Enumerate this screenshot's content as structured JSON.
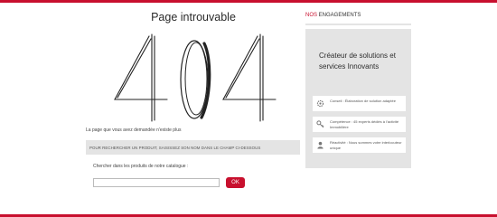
{
  "page": {
    "title": "Page introuvable",
    "error_code": "404",
    "message": "La page que vous avez demandée n'existe plus",
    "info_band": "POUR RECHERCHER UN PRODUIT, SAISISSEZ SON NOM DANS LE CHAMP CI-DESSOUS"
  },
  "search": {
    "label": "Chercher dans les produits de notre catalogue :",
    "value": "",
    "placeholder": "",
    "button_label": "OK"
  },
  "sidebar": {
    "heading_highlight": "NOS",
    "heading_rest": " ENGAGEMENTS",
    "panel_title": "Créateur de solutions et services Innovants",
    "features": [
      {
        "icon": "gear-icon",
        "text": "Conseil : Élaboration de solution adaptée"
      },
      {
        "icon": "key-icon",
        "text": "Compétence : 45 experts dédiés à l'activité Immobilière"
      },
      {
        "icon": "person-icon",
        "text": "Réactivité : Nous sommes votre interlocuteur unique"
      }
    ]
  },
  "colors": {
    "accent": "#c8102e",
    "panel": "#e4e4e4",
    "band": "#e4e4e4"
  }
}
